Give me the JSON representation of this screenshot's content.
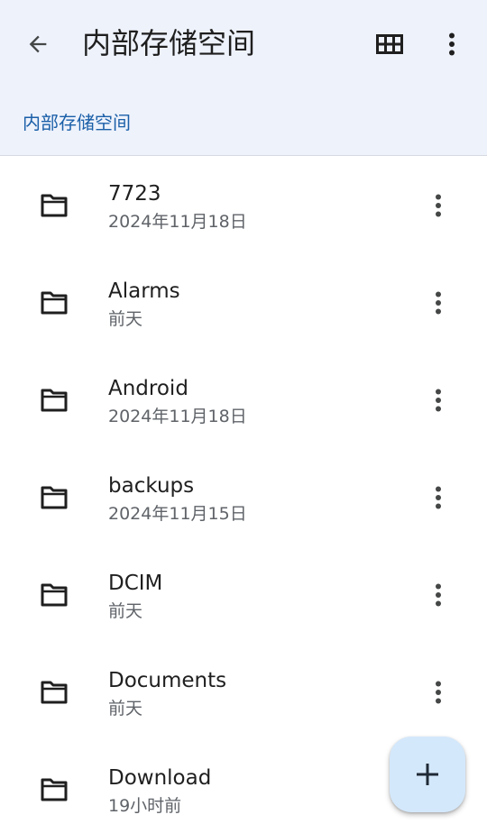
{
  "header": {
    "back_icon": "arrow-left-icon",
    "title": "内部存储空间",
    "grid_icon": "grid-view-icon",
    "more_icon": "more-vert-icon"
  },
  "breadcrumb": {
    "label": "内部存储空间"
  },
  "files": [
    {
      "name": "7723",
      "date": "2024年11月18日",
      "icon": "folder-icon"
    },
    {
      "name": "Alarms",
      "date": "前天",
      "icon": "folder-icon"
    },
    {
      "name": "Android",
      "date": "2024年11月18日",
      "icon": "folder-icon"
    },
    {
      "name": "backups",
      "date": "2024年11月15日",
      "icon": "folder-icon"
    },
    {
      "name": "DCIM",
      "date": "前天",
      "icon": "folder-icon"
    },
    {
      "name": "Documents",
      "date": "前天",
      "icon": "folder-icon"
    },
    {
      "name": "Download",
      "date": "19小时前",
      "icon": "folder-icon"
    }
  ],
  "fab": {
    "icon": "plus-icon"
  },
  "colors": {
    "header_bg": "#eef2fb",
    "breadcrumb": "#1a5fa8",
    "fab_bg": "#d4e8fb",
    "text_primary": "#1f1f1f",
    "text_secondary": "#5f6368"
  }
}
